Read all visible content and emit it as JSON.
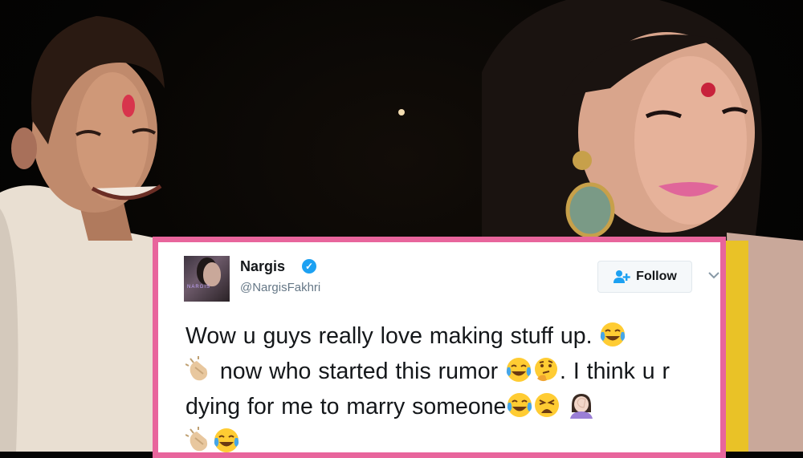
{
  "tweet": {
    "name": "Nargis",
    "handle": "@NargisFakhri",
    "follow_label": "Follow",
    "verified_icon": "check-badge-icon",
    "avatar_text": "NARGIS",
    "text_parts": [
      "Wow u guys really love making stuff up. ",
      " now who started this rumor ",
      ". I think u r dying for me to marry someone",
      ""
    ]
  },
  "colors": {
    "card_border": "#e8659c",
    "verified_blue": "#1da1f2",
    "follow_icon_blue": "#1da1f2",
    "text": "#14171a",
    "secondary_text": "#657786"
  },
  "icons": {
    "emoji": [
      "face-with-tears-of-joy-icon",
      "clapping-hands-icon",
      "thinking-face-icon",
      "weary-face-icon",
      "woman-facepalming-icon"
    ]
  }
}
